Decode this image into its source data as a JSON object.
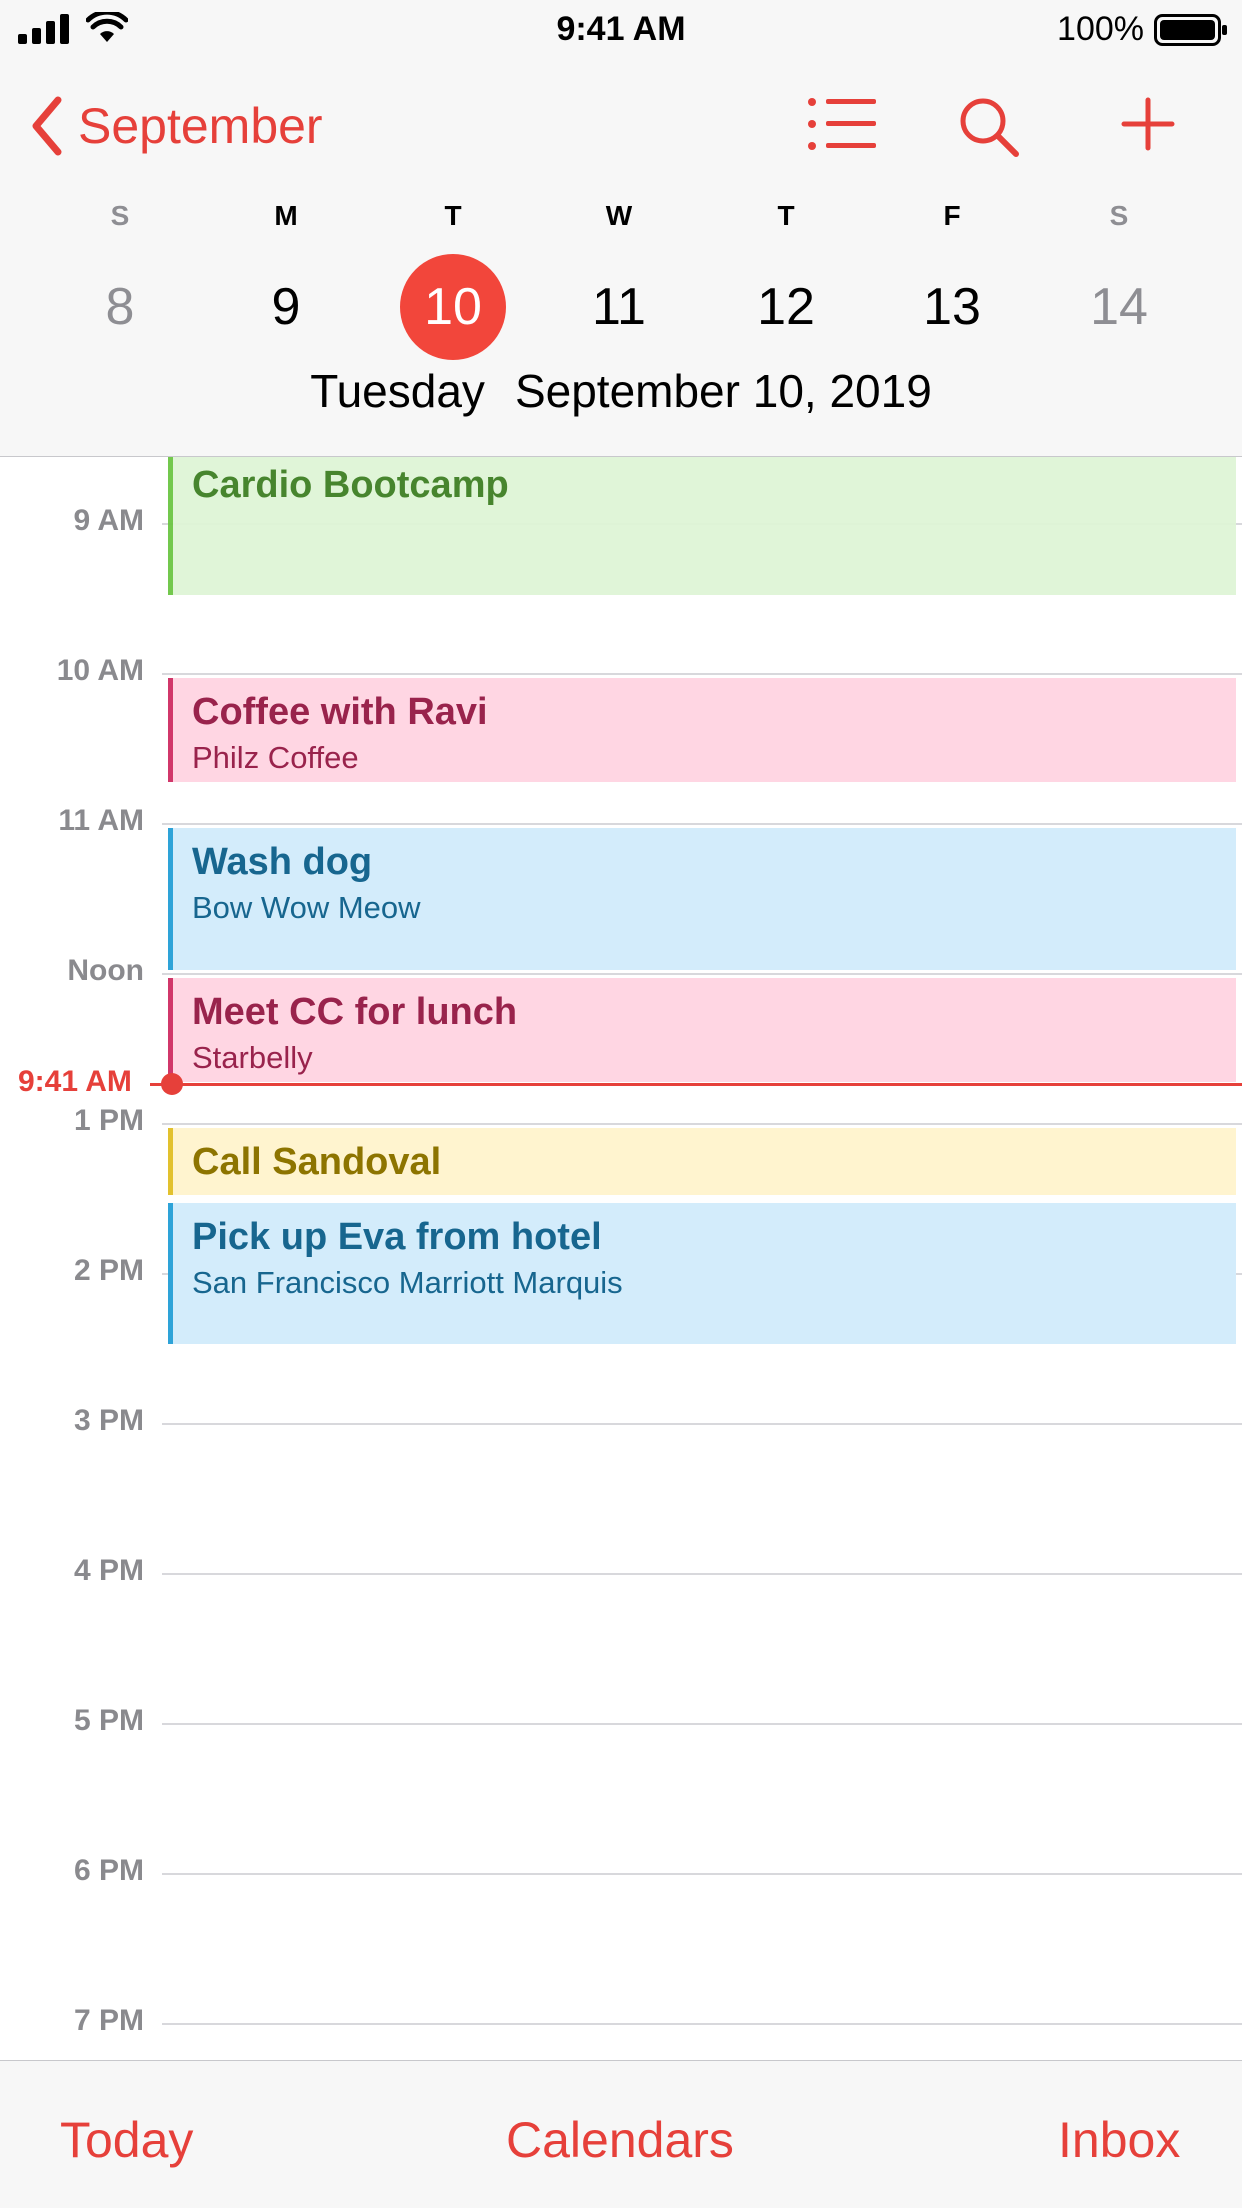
{
  "status_bar": {
    "time": "9:41 AM",
    "battery": "100%"
  },
  "nav": {
    "back_label": "September",
    "icons": [
      "chevron-left-icon",
      "list-icon",
      "search-icon",
      "plus-icon"
    ]
  },
  "week": {
    "days": [
      "S",
      "M",
      "T",
      "W",
      "T",
      "F",
      "S"
    ],
    "dates": [
      "8",
      "9",
      "10",
      "11",
      "12",
      "13",
      "14"
    ],
    "selected_index": 2
  },
  "day_header": {
    "weekday": "Tuesday",
    "date": "September 10, 2019"
  },
  "timeline": {
    "now_label": "9:41 AM",
    "hours": [
      "9 AM",
      "10 AM",
      "11 AM",
      "Noon",
      "1 PM",
      "2 PM",
      "3 PM",
      "4 PM",
      "5 PM",
      "6 PM",
      "7 PM"
    ],
    "events": [
      {
        "title": "Cardio Bootcamp",
        "location": ""
      },
      {
        "title": "Coffee with Ravi",
        "location": "Philz Coffee"
      },
      {
        "title": "Wash dog",
        "location": "Bow Wow Meow"
      },
      {
        "title": "Meet CC for lunch",
        "location": "Starbelly"
      },
      {
        "title": "Call Sandoval",
        "location": ""
      },
      {
        "title": "Pick up Eva from hotel",
        "location": "San Francisco Marriott Marquis"
      }
    ]
  },
  "colors": {
    "accent": "#e6403a",
    "green": "#dff5d6",
    "pink": "#ffd6e3",
    "blue": "#d3ecfb",
    "yellow": "#fff4cf"
  },
  "tab_bar": {
    "today": "Today",
    "calendars": "Calendars",
    "inbox": "Inbox"
  }
}
